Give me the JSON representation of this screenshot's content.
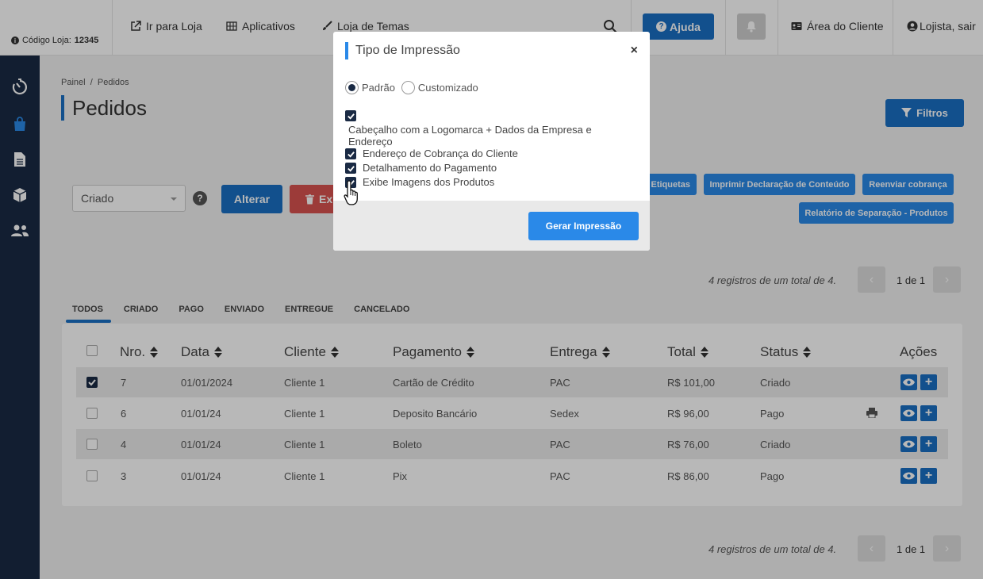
{
  "header": {
    "store_code_label": "Código Loja:",
    "store_code_value": "12345",
    "nav": [
      {
        "label": "Ir para Loja",
        "icon": "external-link-icon"
      },
      {
        "label": "Aplicativos",
        "icon": "grid-icon"
      },
      {
        "label": "Loja de Temas",
        "icon": "brush-icon"
      }
    ],
    "help_label": "Ajuda",
    "client_area_label": "Área do Cliente",
    "logout_label": "Lojista, sair"
  },
  "breadcrumb": {
    "home": "Painel",
    "sep": "/",
    "current": "Pedidos"
  },
  "page_title": "Pedidos",
  "filters_label": "Filtros",
  "bulk": {
    "status_value": "Criado",
    "help": "?",
    "alter_label": "Alterar",
    "delete_label": "Ex",
    "actions": [
      "Etiquetas",
      "Imprimir Declaração de Conteúdo",
      "Reenviar cobrança",
      "Relatório de Separação - Produtos"
    ]
  },
  "pagination": {
    "summary": "4 registros de um total de 4.",
    "page": "1 de 1"
  },
  "tabs": [
    "TODOS",
    "CRIADO",
    "PAGO",
    "ENVIADO",
    "ENTREGUE",
    "CANCELADO"
  ],
  "table": {
    "columns": [
      "Nro.",
      "Data",
      "Cliente",
      "Pagamento",
      "Entrega",
      "Total",
      "Status",
      "Ações"
    ],
    "rows": [
      {
        "nro": "7",
        "data": "01/01/2024",
        "cliente": "Cliente 1",
        "pagamento": "Cartão de Crédito",
        "entrega": "PAC",
        "total": "R$ 101,00",
        "status": "Criado",
        "checked": true
      },
      {
        "nro": "6",
        "data": "01/01/24",
        "cliente": "Cliente 1",
        "pagamento": "Deposito Bancário",
        "entrega": "Sedex",
        "total": "R$ 96,00",
        "status": "Pago",
        "checked": false
      },
      {
        "nro": "4",
        "data": "01/01/24",
        "cliente": "Cliente 1",
        "pagamento": "Boleto",
        "entrega": "PAC",
        "total": "R$ 76,00",
        "status": "Criado",
        "checked": false
      },
      {
        "nro": "3",
        "data": "01/01/24",
        "cliente": "Cliente 1",
        "pagamento": "Pix",
        "entrega": "PAC",
        "total": "R$ 86,00",
        "status": "Pago",
        "checked": false
      }
    ]
  },
  "modal": {
    "title": "Tipo de Impressão",
    "close": "×",
    "radio_default": "Padrão",
    "radio_custom": "Customizado",
    "opt_header_line1": "Cabeçalho com a Logomarca + Dados da Empresa e",
    "opt_header_line2": "Endereço",
    "opt_billing": "Endereço de Cobrança do Cliente",
    "opt_payment": "Detalhamento do Pagamento",
    "opt_images": "Exibe Imagens dos Produtos",
    "generate_label": "Gerar Impressão"
  },
  "colors": {
    "primary": "#1a6fc4",
    "sidebar": "#1a2a44",
    "danger": "#d9534f",
    "action": "#2a89e8"
  }
}
